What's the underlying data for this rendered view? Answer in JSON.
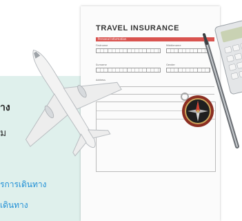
{
  "side_text": {
    "line1": "าง",
    "line2": "ม",
    "line3": "รการเดินทาง",
    "line4": "เดินทาง"
  },
  "document": {
    "title": "TRAVEL INSURANCE",
    "section_header": "Personal Information",
    "fields": {
      "firstname": "Firstname",
      "middlename": "Middlename",
      "surname": "Surname",
      "gender": "Gender",
      "address": "Address"
    }
  },
  "icons": {
    "airplane": "airplane-icon",
    "compass": "compass-icon",
    "calculator": "calculator-icon",
    "pen": "pen-icon"
  },
  "colors": {
    "panel": "#dff0ec",
    "accent_text": "#1f8fd6",
    "header_bar": "#d9534f"
  }
}
